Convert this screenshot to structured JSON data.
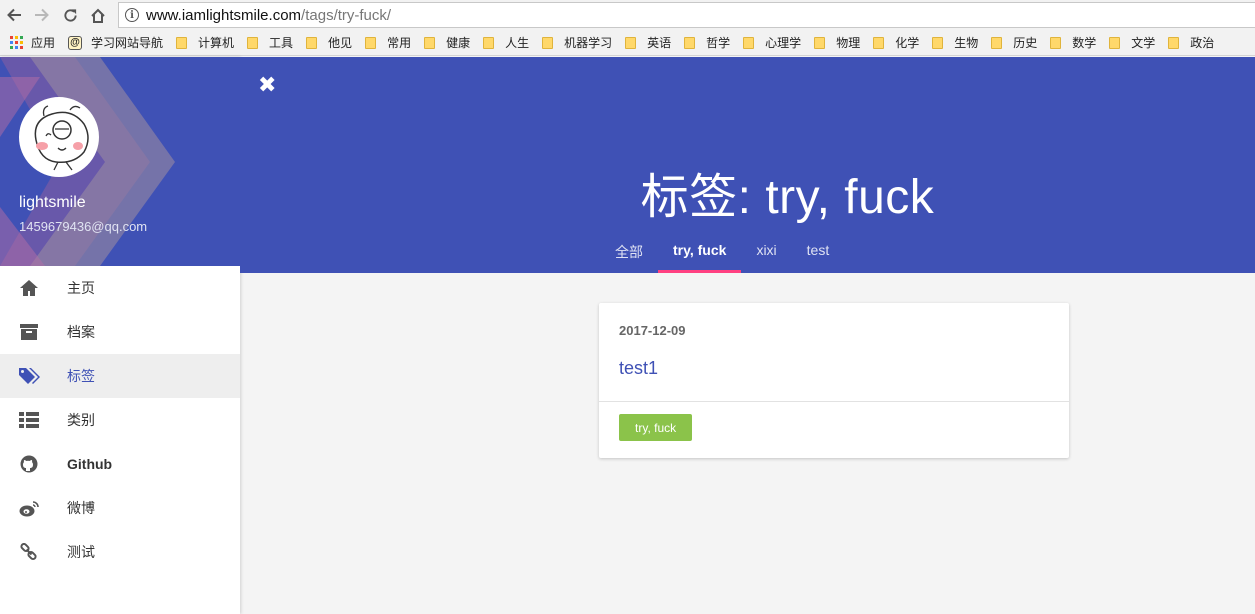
{
  "browser": {
    "url_host": "www.iamlightsmile.com",
    "url_path": "/tags/try-fuck/",
    "bookmarks": {
      "apps": "应用",
      "site": "学习网站导航",
      "folders": [
        "计算机",
        "工具",
        "他见",
        "常用",
        "健康",
        "人生",
        "机器学习",
        "英语",
        "哲学",
        "心理学",
        "物理",
        "化学",
        "生物",
        "历史",
        "数学",
        "文学",
        "政治"
      ]
    }
  },
  "sidebar": {
    "user_name": "lightsmile",
    "user_email": "1459679436@qq.com",
    "items": [
      {
        "label": "主页",
        "icon": "home-icon"
      },
      {
        "label": "档案",
        "icon": "archive-icon"
      },
      {
        "label": "标签",
        "icon": "tags-icon"
      },
      {
        "label": "类别",
        "icon": "list-icon"
      },
      {
        "label": "Github",
        "icon": "github-icon"
      },
      {
        "label": "微博",
        "icon": "weibo-icon"
      },
      {
        "label": "测试",
        "icon": "link-icon"
      }
    ]
  },
  "header": {
    "title": "标签: try, fuck",
    "tabs": [
      "全部",
      "try, fuck",
      "xixi",
      "test"
    ]
  },
  "post": {
    "date": "2017-12-09",
    "title": "test1",
    "tag": "try, fuck"
  },
  "colors": {
    "primary": "#3f51b5",
    "accent": "#ff4081",
    "tag": "#8bc34a"
  }
}
